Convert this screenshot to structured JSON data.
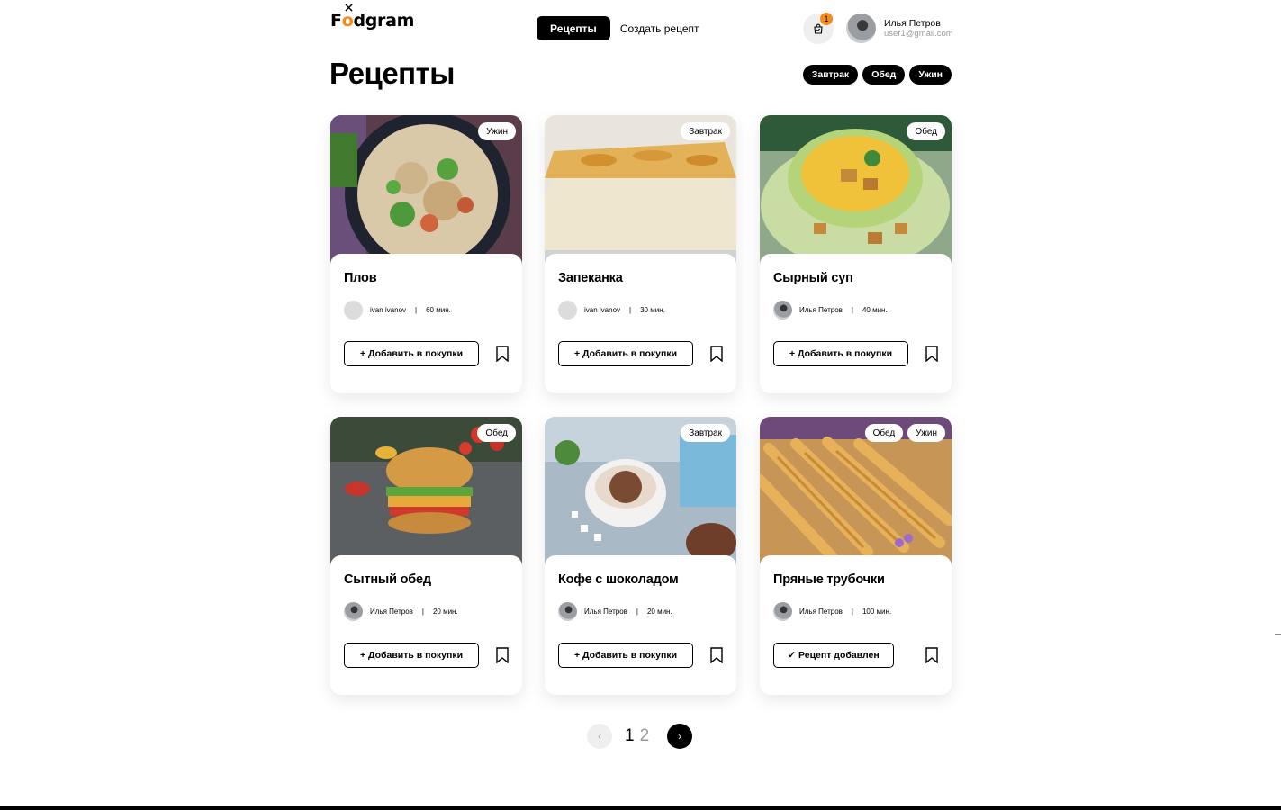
{
  "header": {
    "logo_pre": "F",
    "logo_o": "o",
    "logo_post": "dgram",
    "nav": [
      {
        "label": "Рецепты"
      },
      {
        "label": "Создать рецепт"
      }
    ],
    "cart_count": "1",
    "user": {
      "name": "Илья Петров",
      "email": "user1@gmail.com"
    }
  },
  "page_title": "Рецепты",
  "filters": [
    {
      "label": "Завтрак"
    },
    {
      "label": "Обед"
    },
    {
      "label": "Ужин"
    }
  ],
  "colors": {
    "accent": "#f28a1c",
    "primary": "#000000"
  },
  "recipes": [
    {
      "title": "Плов",
      "tags": [
        "Ужин"
      ],
      "author": "ivan ivanov",
      "time": "60 мин.",
      "button": "+ Добавить в покупки"
    },
    {
      "title": "Запеканка",
      "tags": [
        "Завтрак"
      ],
      "author": "ivan ivanov",
      "time": "30 мин.",
      "button": "+ Добавить в покупки"
    },
    {
      "title": "Сырный суп",
      "tags": [
        "Обед"
      ],
      "author": "Илья Петров",
      "time": "40 мин.",
      "button": "+ Добавить в покупки"
    },
    {
      "title": "Сытный обед",
      "tags": [
        "Обед"
      ],
      "author": "Илья Петров",
      "time": "20 мин.",
      "button": "+ Добавить в покупки"
    },
    {
      "title": "Кофе с шоколадом",
      "tags": [
        "Завтрак"
      ],
      "author": "Илья Петров",
      "time": "20 мин.",
      "button": "+ Добавить в покупки"
    },
    {
      "title": "Пряные трубочки",
      "tags": [
        "Обед",
        "Ужин"
      ],
      "author": "Илья Петров",
      "time": "100 мин.",
      "button": "✓ Рецепт добавлен"
    }
  ],
  "pagination": {
    "pages": [
      "1",
      "2"
    ],
    "prev": "‹",
    "next": "›"
  }
}
